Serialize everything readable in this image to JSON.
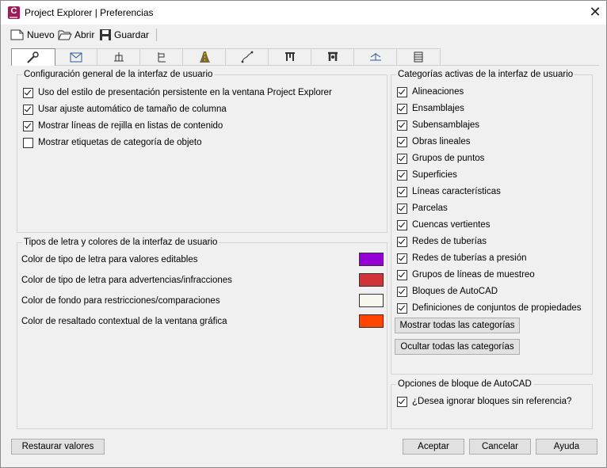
{
  "window": {
    "title": "Project Explorer | Preferencias",
    "app_icon_letter": "C"
  },
  "toolbar": {
    "new_label": "Nuevo",
    "open_label": "Abrir",
    "save_label": "Guardar"
  },
  "tabs": [
    {
      "icon": "wrench-icon"
    },
    {
      "icon": "alignment-view-icon"
    },
    {
      "icon": "assembly-icon"
    },
    {
      "icon": "subassembly-icon"
    },
    {
      "icon": "corridor-icon"
    },
    {
      "icon": "feature-line-icon"
    },
    {
      "icon": "pipe-network-icon"
    },
    {
      "icon": "pressure-network-icon"
    },
    {
      "icon": "sample-line-icon"
    },
    {
      "icon": "table-icon"
    }
  ],
  "general": {
    "title": "Configuración general de la interfaz de usuario",
    "options": [
      {
        "label": "Uso del estilo de presentación persistente en la ventana Project Explorer",
        "checked": true
      },
      {
        "label": "Usar ajuste automático de tamaño de columna",
        "checked": true
      },
      {
        "label": "Mostrar líneas de rejilla en listas de contenido",
        "checked": true
      },
      {
        "label": "Mostrar etiquetas de categoría de objeto",
        "checked": false
      }
    ]
  },
  "fonts_colors": {
    "title": "Tipos de letra y colores de la interfaz de usuario",
    "rows": [
      {
        "label": "Color de tipo de letra para valores editables",
        "color": "#9400d3"
      },
      {
        "label": "Color de tipo de letra para advertencias/infracciones",
        "color": "#d13438"
      },
      {
        "label": "Color de fondo para restricciones/comparaciones",
        "color": "#f7f7ef"
      },
      {
        "label": "Color de resaltado contextual de la ventana gráfica",
        "color": "#ff4500"
      }
    ]
  },
  "categories": {
    "title": "Categorías activas de la interfaz de usuario",
    "items": [
      {
        "label": "Alineaciones",
        "checked": true
      },
      {
        "label": "Ensamblajes",
        "checked": true
      },
      {
        "label": "Subensamblajes",
        "checked": true
      },
      {
        "label": "Obras lineales",
        "checked": true
      },
      {
        "label": "Grupos de puntos",
        "checked": true
      },
      {
        "label": "Superficies",
        "checked": true
      },
      {
        "label": "Líneas características",
        "checked": true
      },
      {
        "label": "Parcelas",
        "checked": true
      },
      {
        "label": "Cuencas vertientes",
        "checked": true
      },
      {
        "label": "Redes de tuberías",
        "checked": true
      },
      {
        "label": "Redes de tuberías a presión",
        "checked": true
      },
      {
        "label": "Grupos de líneas de muestreo",
        "checked": true
      },
      {
        "label": "Bloques de AutoCAD",
        "checked": true
      },
      {
        "label": "Definiciones de conjuntos de propiedades",
        "checked": true
      }
    ],
    "show_all_label": "Mostrar todas las categorías",
    "hide_all_label": "Ocultar todas las categorías"
  },
  "block_options": {
    "title": "Opciones de bloque de AutoCAD",
    "ignore_label": "¿Desea ignorar bloques sin referencia?",
    "ignore_checked": true
  },
  "footer": {
    "restore_label": "Restaurar valores",
    "accept_label": "Aceptar",
    "cancel_label": "Cancelar",
    "help_label": "Ayuda"
  }
}
